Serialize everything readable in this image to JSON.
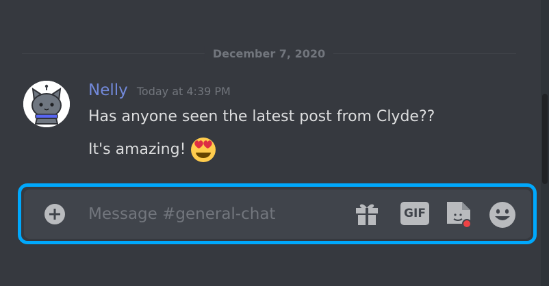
{
  "chat": {
    "date_divider": "December 7, 2020",
    "message": {
      "author": "Nelly",
      "timestamp": "Today at 4:39 PM",
      "lines": [
        "Has anyone seen the latest post from Clyde??",
        "It's amazing!"
      ],
      "emoji": "heart-eyes"
    }
  },
  "input": {
    "placeholder": "Message #general-chat",
    "gif_label": "GIF"
  },
  "colors": {
    "background": "#36393f",
    "username": "#7289da",
    "focus_outline": "#00a8fc",
    "notification_dot": "#ed4245"
  }
}
